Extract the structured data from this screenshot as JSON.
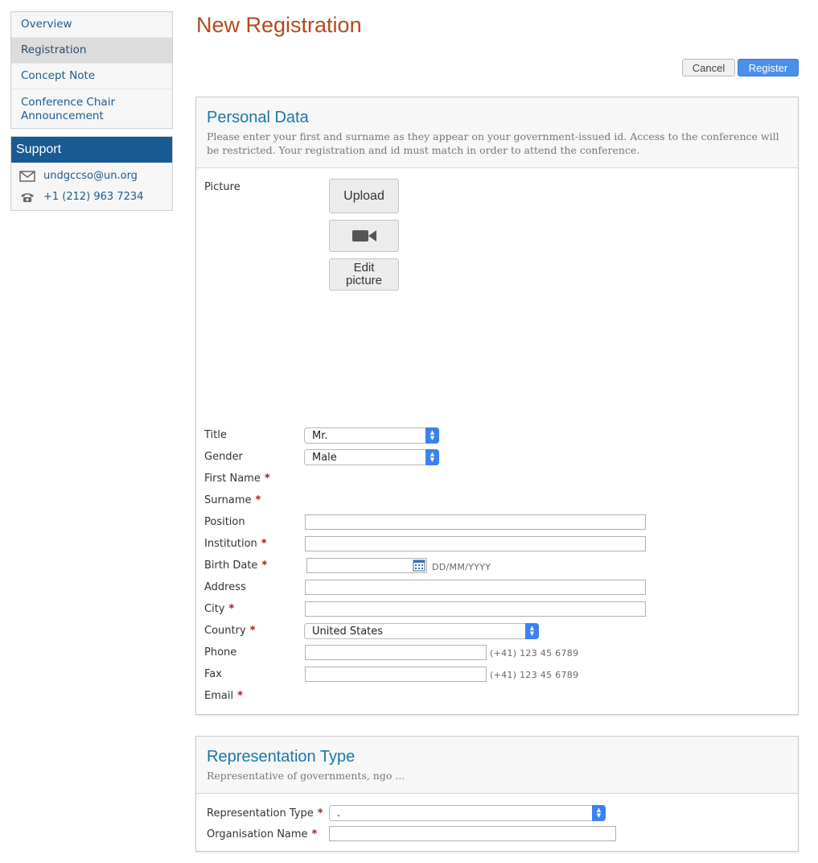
{
  "nav": {
    "items": [
      {
        "label": "Overview"
      },
      {
        "label": "Registration"
      },
      {
        "label": "Concept Note"
      },
      {
        "label": "Conference Chair Announcement"
      }
    ]
  },
  "support": {
    "title": "Support",
    "email": "undgccso@un.org",
    "phone": "+1 (212) 963 7234"
  },
  "page": {
    "title": "New Registration",
    "cancel_label": "Cancel",
    "register_label": "Register"
  },
  "personal": {
    "title": "Personal Data",
    "description": "Please enter your first and surname as they appear on your government-issued id. Access to the conference will be restricted. Your registration and id must match in order to attend the conference.",
    "picture_label": "Picture",
    "upload_label": "Upload",
    "edit_picture_label": "Edit picture",
    "fields": {
      "title_label": "Title",
      "title_value": "Mr.",
      "gender_label": "Gender",
      "gender_value": "Male",
      "first_name_label": "First Name",
      "surname_label": "Surname",
      "position_label": "Position",
      "institution_label": "Institution",
      "birth_date_label": "Birth Date",
      "birth_date_hint": "DD/MM/YYYY",
      "address_label": "Address",
      "city_label": "City",
      "country_label": "Country",
      "country_value": "United States",
      "phone_label": "Phone",
      "phone_hint": "(+41) 123 45 6789",
      "fax_label": "Fax",
      "fax_hint": "(+41) 123 45 6789",
      "email_label": "Email"
    },
    "required_mark": "*"
  },
  "representation": {
    "title": "Representation Type",
    "description": "Representative of governments, ngo ...",
    "type_label": "Representation Type",
    "type_value": ".",
    "org_label": "Organisation Name"
  },
  "colors": {
    "title": "#b5491b",
    "panel_title": "#1a76a9",
    "support_head": "#1a5a94",
    "register_button": "#4a90e8",
    "required": "#a3191b"
  }
}
